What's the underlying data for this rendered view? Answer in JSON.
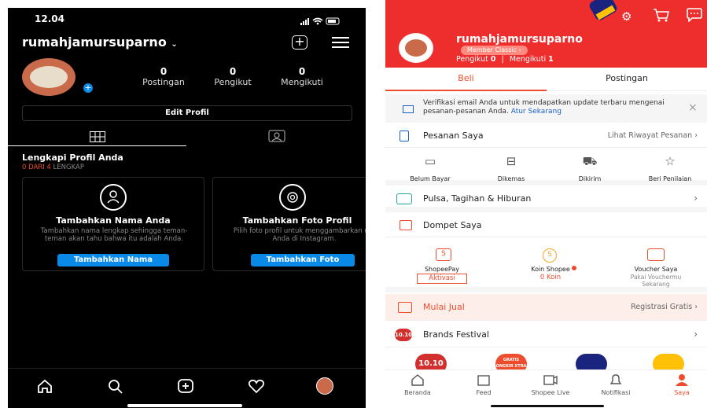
{
  "instagram": {
    "status_time": "12.04",
    "username": "rumahjamursuparno",
    "stats": [
      {
        "num": "0",
        "label": "Postingan"
      },
      {
        "num": "0",
        "label": "Pengikut"
      },
      {
        "num": "0",
        "label": "Mengikuti"
      }
    ],
    "edit_profile_label": "Edit Profil",
    "complete_profile_title": "Lengkapi Profil Anda",
    "progress_done": "0 DARI 4",
    "progress_label": "LENGKAP",
    "cards": [
      {
        "title": "Tambahkan Nama Anda",
        "desc": "Tambahkan nama lengkap sehingga teman-teman akan tahu bahwa itu adalah Anda.",
        "button": "Tambahkan Nama"
      },
      {
        "title": "Tambahkan Foto Profil",
        "desc": "Pilih foto profil untuk menggambarkan diri Anda di Instagram.",
        "button": "Tambahkan Foto"
      }
    ]
  },
  "shopee": {
    "username": "rumahjamursuparno",
    "member_badge": "Member Classic",
    "followers_label": "Pengikut",
    "followers_count": "0",
    "following_label": "Mengikuti",
    "following_count": "1",
    "tabs": [
      "Beli",
      "Postingan"
    ],
    "notice_text": "Verifikasi email Anda untuk mendapatkan update terbaru mengenai pesanan-pesanan Anda.",
    "notice_link": "Atur Sekarang",
    "orders_title": "Pesanan Saya",
    "orders_history": "Lihat Riwayat Pesanan",
    "order_states": [
      "Belum Bayar",
      "Dikemas",
      "Dikirim",
      "Beri Penilaian"
    ],
    "pulsa_title": "Pulsa, Tagihan & Hiburan",
    "wallet_title": "Dompet Saya",
    "wallet_items": [
      {
        "name": "ShopeePay",
        "value": "Aktivasi"
      },
      {
        "name": "Koin Shopee",
        "value": "0 Koin"
      },
      {
        "name": "Voucher Saya",
        "value": "Pakai Vouchermu Sekarang"
      }
    ],
    "sell_title": "Mulai Jual",
    "sell_right": "Registrasi Gratis",
    "brands_title": "Brands Festival",
    "brands_badge": "10.10",
    "banner_text": "GRATIS ONGKIR XTRA",
    "nav": [
      "Beranda",
      "Feed",
      "Shopee Live",
      "Notifikasi",
      "Saya"
    ],
    "accent": "#ee4d2d"
  }
}
